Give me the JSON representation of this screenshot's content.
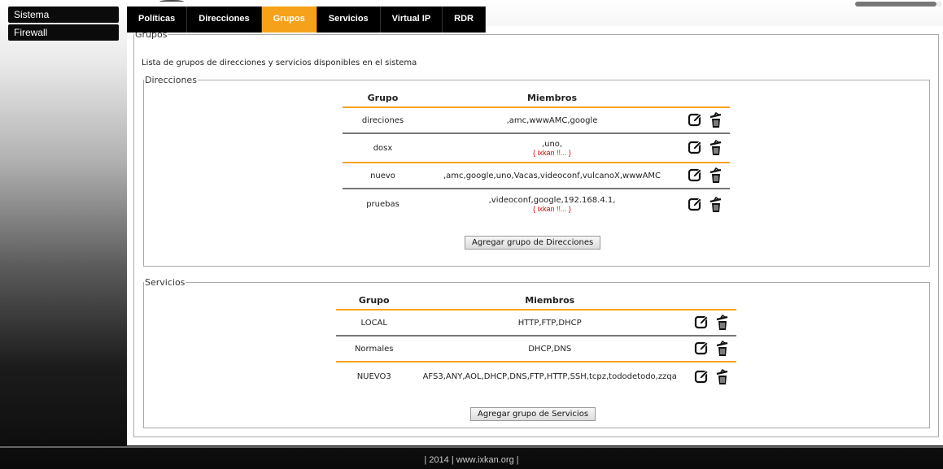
{
  "sidebar": {
    "items": [
      {
        "label": "Sistema"
      },
      {
        "label": "Firewall"
      }
    ]
  },
  "tabs": [
    {
      "label": "Políticas"
    },
    {
      "label": "Direcciones"
    },
    {
      "label": "Grupos",
      "active": true
    },
    {
      "label": "Servicios"
    },
    {
      "label": "Virtual IP"
    },
    {
      "label": "RDR"
    }
  ],
  "colors": {
    "accent": "#f5a21a",
    "warning": "#d31010",
    "nav_bg": "#000000"
  },
  "main": {
    "legend": "Grupos",
    "description": "Lista de grupos de direcciones y servicios disponibles en el sistema",
    "direcciones": {
      "legend": "Direcciones",
      "headers": {
        "group": "Grupo",
        "members": "Miembros"
      },
      "rows": [
        {
          "group": "direciones",
          "members": ",amc,wwwAMC,google",
          "warning": ""
        },
        {
          "group": "dosx",
          "members": ",uno,",
          "warning": "{ ixkan !!... }"
        },
        {
          "group": "nuevo",
          "members": ",amc,google,uno,Vacas,videoconf,vulcanoX,wwwAMC",
          "warning": ""
        },
        {
          "group": "pruebas",
          "members": ",videoconf,google,192.168.4.1,",
          "warning": "{ ixkan !!... }"
        }
      ],
      "add_button": "Agregar grupo de Direcciones"
    },
    "servicios": {
      "legend": "Servicios",
      "headers": {
        "group": "Grupo",
        "members": "Miembros"
      },
      "rows": [
        {
          "group": "LOCAL",
          "members": "HTTP,FTP,DHCP"
        },
        {
          "group": "Normales",
          "members": "DHCP,DNS"
        },
        {
          "group": "NUEVO3",
          "members": "AFS3,ANY,AOL,DHCP,DNS,FTP,HTTP,SSH,tcpz,tododetodo,zzqa"
        }
      ],
      "add_button": "Agregar grupo de Servicios"
    }
  },
  "icons": {
    "edit": "edit-icon",
    "delete": "trash-icon"
  },
  "footer": {
    "prefix": "| 2014 |",
    "link": "www.ixkan.org",
    "suffix": "|"
  }
}
